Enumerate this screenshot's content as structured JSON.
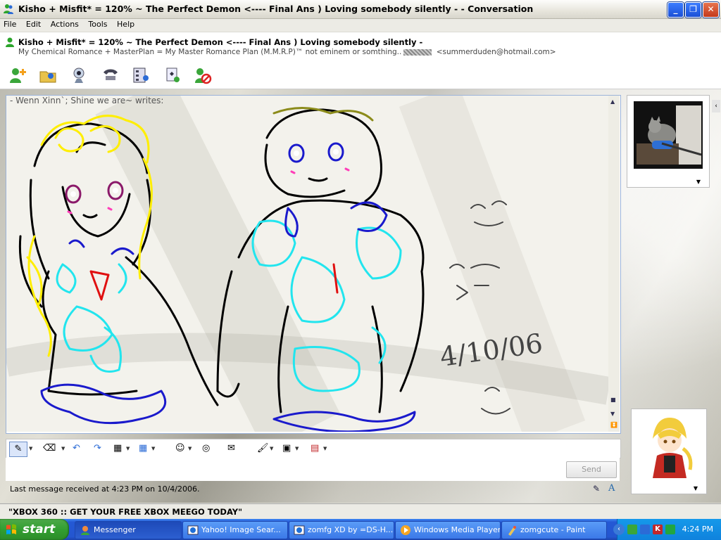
{
  "window": {
    "title": "Kisho + Misfit* = 120% ~ The Perfect Demon <---- Final Ans ) Loving somebody silently - - Conversation",
    "buttons": [
      "_",
      "❐",
      "✕"
    ]
  },
  "menu": [
    "File",
    "Edit",
    "Actions",
    "Tools",
    "Help"
  ],
  "contact": {
    "name": "Kisho + Misfit* = 120% ~ The Perfect Demon <---- Final Ans ) Loving somebody silently -",
    "personal_message": "My Chemical Romance + MasterPlan = My Master Romance Plan (M.M.R.P)™ not eminem or somthing..",
    "email": "<summerduden@hotmail.com>"
  },
  "toolbar_icons": [
    "invite-contact-icon",
    "send-files-icon",
    "webcam-icon",
    "call-icon",
    "activities-icon",
    "games-icon",
    "block-icon"
  ],
  "conversation": {
    "writes": "- Wenn Xinn`; Shine we are~ writes:",
    "handwriting": [
      "4/10/06"
    ],
    "last_message": "Last message received at 4:23 PM on 10/4/2006."
  },
  "ink_tools": [
    "pen-icon",
    "eraser-icon",
    "undo-icon",
    "redo-icon",
    "color-icon",
    "grid-icon",
    "emoticon-icon",
    "voice-clip-icon",
    "nudge-icon",
    "brush-icon",
    "background-icon",
    "gift-icon"
  ],
  "composer": {
    "send_label": "Send"
  },
  "adbar": {
    "text": "\"XBOX 360 :: GET YOUR FREE XBOX MEEGO TODAY\""
  },
  "taskbar": {
    "start_label": "start",
    "tasks": [
      {
        "label": "Messenger"
      },
      {
        "label": "Yahoo! Image Sear..."
      },
      {
        "label": "zomfg XD by =DS-H..."
      },
      {
        "label": "Windows Media Player"
      },
      {
        "label": "zomgcute - Paint"
      }
    ],
    "clock": "4:24 PM"
  },
  "colors": {
    "xp_blue": "#2458d4",
    "start_green": "#329f31",
    "tray_blue": "#0f82dd",
    "ink_black": "#000000",
    "ink_yellow": "#ffee00",
    "ink_cyan": "#22e5ee",
    "ink_blue": "#1a1acc",
    "ink_olive": "#8b8b1a",
    "ink_purple": "#8b1a6a",
    "ink_red": "#e01010"
  }
}
